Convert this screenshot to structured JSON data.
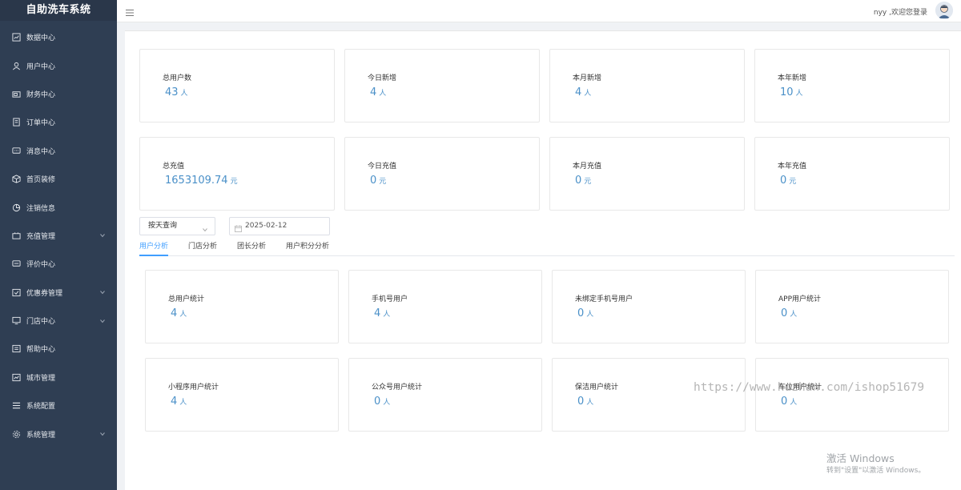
{
  "app": {
    "title": "自助洗车系统"
  },
  "sidebar": {
    "items": [
      {
        "label": "数据中心",
        "icon": "chart-icon",
        "expandable": false
      },
      {
        "label": "用户中心",
        "icon": "user-icon",
        "expandable": false
      },
      {
        "label": "财务中心",
        "icon": "wallet-icon",
        "expandable": false
      },
      {
        "label": "订单中心",
        "icon": "document-icon",
        "expandable": false
      },
      {
        "label": "消息中心",
        "icon": "message-icon",
        "expandable": false
      },
      {
        "label": "首页装修",
        "icon": "box-icon",
        "expandable": false
      },
      {
        "label": "注销信息",
        "icon": "pie-icon",
        "expandable": false
      },
      {
        "label": "充值管理",
        "icon": "recharge-icon",
        "expandable": true
      },
      {
        "label": "评价中心",
        "icon": "comment-icon",
        "expandable": false
      },
      {
        "label": "优惠券管理",
        "icon": "coupon-icon",
        "expandable": true
      },
      {
        "label": "门店中心",
        "icon": "monitor-icon",
        "expandable": true
      },
      {
        "label": "帮助中心",
        "icon": "help-icon",
        "expandable": false
      },
      {
        "label": "城市管理",
        "icon": "city-icon",
        "expandable": false
      },
      {
        "label": "系统配置",
        "icon": "list-icon",
        "expandable": false
      },
      {
        "label": "系统管理",
        "icon": "gear-icon",
        "expandable": true
      }
    ]
  },
  "header": {
    "greeting": "nyy ,欢迎您登录"
  },
  "stats_row1": [
    {
      "label": "总用户数",
      "value": "43",
      "unit": "人"
    },
    {
      "label": "今日新增",
      "value": "4",
      "unit": "人"
    },
    {
      "label": "本月新增",
      "value": "4",
      "unit": "人"
    },
    {
      "label": "本年新增",
      "value": "10",
      "unit": "人"
    }
  ],
  "stats_row2": [
    {
      "label": "总充值",
      "value": "1653109.74",
      "unit": "元"
    },
    {
      "label": "今日充值",
      "value": "0",
      "unit": "元"
    },
    {
      "label": "本月充值",
      "value": "0",
      "unit": "元"
    },
    {
      "label": "本年充值",
      "value": "0",
      "unit": "元"
    }
  ],
  "filter": {
    "query_mode": "按天查询",
    "date": "2025-02-12"
  },
  "tabs": [
    {
      "label": "用户分析",
      "active": true
    },
    {
      "label": "门店分析",
      "active": false
    },
    {
      "label": "团长分析",
      "active": false
    },
    {
      "label": "用户积分分析",
      "active": false
    }
  ],
  "analysis_row1": [
    {
      "label": "总用户统计",
      "value": "4",
      "unit": "人"
    },
    {
      "label": "手机号用户",
      "value": "4",
      "unit": "人"
    },
    {
      "label": "未绑定手机号用户",
      "value": "0",
      "unit": "人"
    },
    {
      "label": "APP用户统计",
      "value": "0",
      "unit": "人"
    }
  ],
  "analysis_row2": [
    {
      "label": "小程序用户统计",
      "value": "4",
      "unit": "人"
    },
    {
      "label": "公众号用户统计",
      "value": "0",
      "unit": "人"
    },
    {
      "label": "保洁用户统计",
      "value": "0",
      "unit": "人"
    },
    {
      "label": "车位用户统计",
      "value": "0",
      "unit": "人"
    }
  ],
  "overlay": {
    "watermark": "https://www.huzhan.com/ishop51679",
    "activate_title": "激活 Windows",
    "activate_sub": "转到\"设置\"以激活 Windows。"
  },
  "colors": {
    "sidebar_bg": "#2f3e53",
    "accent": "#409eff",
    "value_blue": "#4a90c8"
  }
}
